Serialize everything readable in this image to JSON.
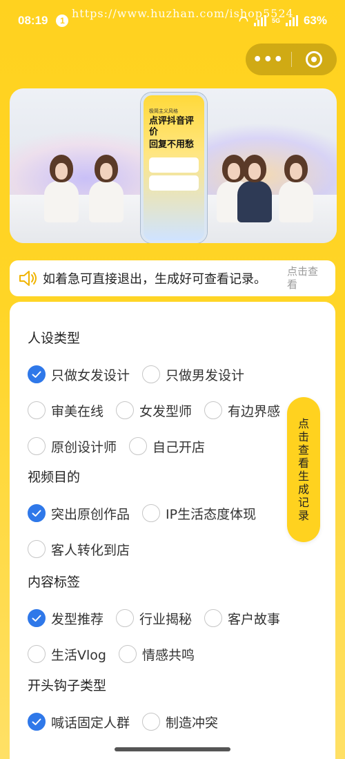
{
  "status": {
    "time": "08:19",
    "notification_count": "1",
    "battery": "63%",
    "network": "5G"
  },
  "watermark": "https://www.huzhan.com/ishop5524",
  "capsule": {
    "more_label": "•••"
  },
  "banner": {
    "phone_small_text": "极简主义风格",
    "phone_headline_1": "点评抖音评价",
    "phone_headline_2": "回复不用愁"
  },
  "notice": {
    "message": "如着急可直接退出，生成好可查看记录。",
    "view_label": "点击查看"
  },
  "form": {
    "sections": [
      {
        "title": "人设类型",
        "rows": [
          [
            {
              "label": "只做女发设计",
              "checked": true
            },
            {
              "label": "只做男发设计",
              "checked": false
            }
          ],
          [
            {
              "label": "审美在线",
              "checked": false
            },
            {
              "label": "女发型师",
              "checked": false
            },
            {
              "label": "有边界感",
              "checked": false
            }
          ],
          [
            {
              "label": "原创设计师",
              "checked": false
            },
            {
              "label": "自己开店",
              "checked": false
            }
          ]
        ]
      },
      {
        "title": "视频目的",
        "rows": [
          [
            {
              "label": "突出原创作品",
              "checked": true
            },
            {
              "label": "IP生活态度体现",
              "checked": false
            }
          ],
          [
            {
              "label": "客人转化到店",
              "checked": false
            }
          ]
        ]
      },
      {
        "title": "内容标签",
        "rows": [
          [
            {
              "label": "发型推荐",
              "checked": true
            },
            {
              "label": "行业揭秘",
              "checked": false
            },
            {
              "label": "客户故事",
              "checked": false
            }
          ],
          [
            {
              "label": "生活Vlog",
              "checked": false
            },
            {
              "label": "情感共鸣",
              "checked": false
            }
          ]
        ]
      },
      {
        "title": "开头钩子类型",
        "rows": [
          [
            {
              "label": "喊话固定人群",
              "checked": true
            },
            {
              "label": "制造冲突",
              "checked": false
            }
          ]
        ]
      }
    ]
  },
  "float_button": {
    "label": "点击查看生成记录"
  },
  "colors": {
    "accent_yellow": "#ffd21f",
    "check_blue": "#2f78e9"
  }
}
